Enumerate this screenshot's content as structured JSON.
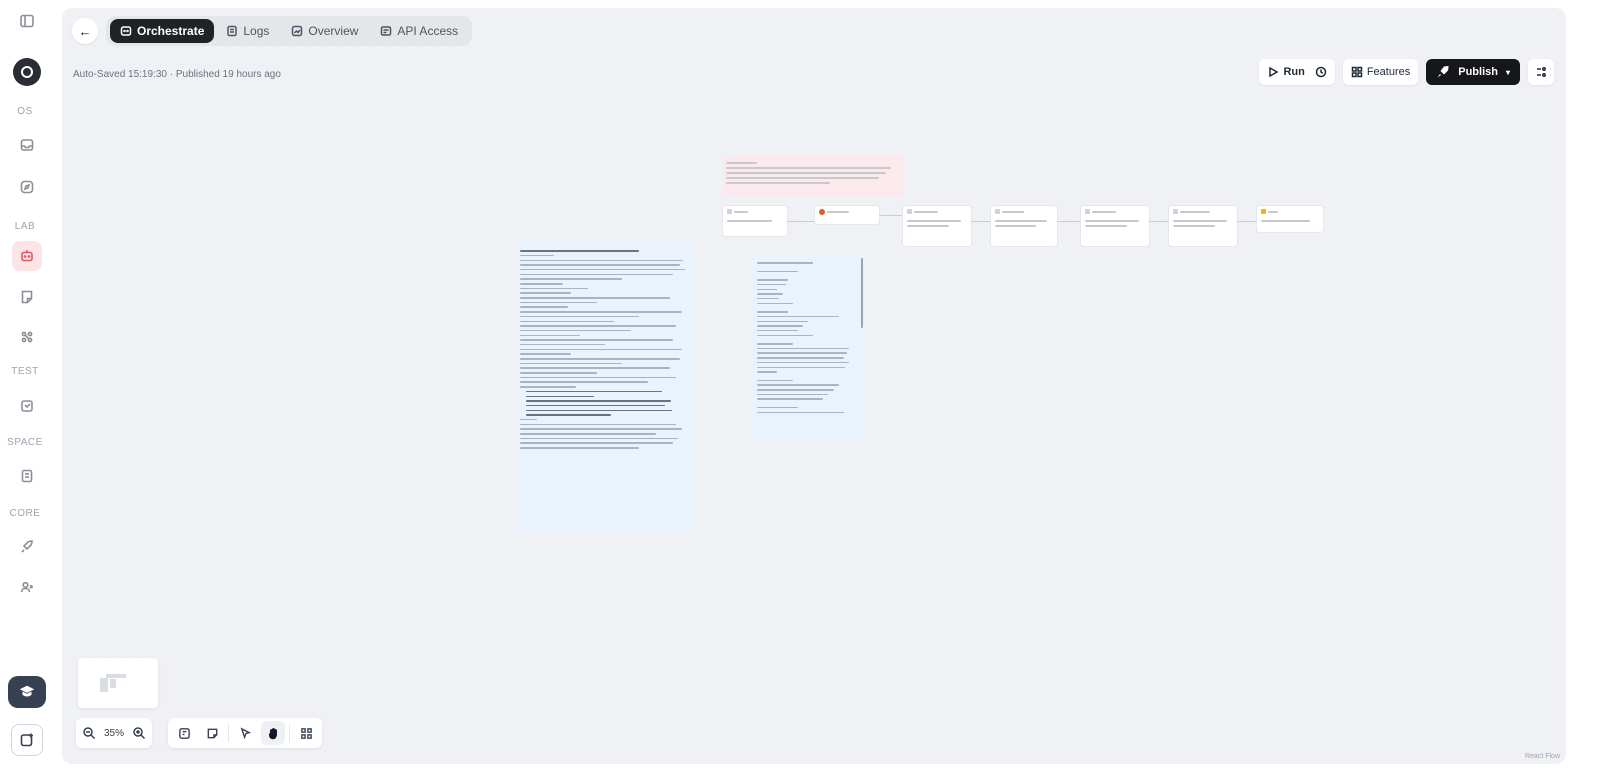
{
  "rail": {
    "sections": [
      "OS",
      "LAB",
      "TEST",
      "SPACE",
      "CORE"
    ],
    "items": [
      {
        "name": "sidebar-toggle",
        "icon": "panel-left-icon"
      },
      {
        "name": "app-logo",
        "icon": "logo-icon"
      },
      {
        "name": "os-item-1",
        "icon": "inbox-icon"
      },
      {
        "name": "os-item-2",
        "icon": "compass-icon"
      },
      {
        "name": "lab-item-1",
        "icon": "bot-icon",
        "active": true
      },
      {
        "name": "lab-item-2",
        "icon": "note-icon"
      },
      {
        "name": "lab-item-3",
        "icon": "nodes-icon"
      },
      {
        "name": "test-item-1",
        "icon": "flask-icon"
      },
      {
        "name": "space-item-1",
        "icon": "book-icon"
      },
      {
        "name": "core-item-1",
        "icon": "rocket-icon"
      },
      {
        "name": "core-item-2",
        "icon": "users-icon"
      }
    ]
  },
  "header": {
    "tabs": [
      {
        "label": "Orchestrate",
        "icon": "orchestrate-icon",
        "active": true
      },
      {
        "label": "Logs",
        "icon": "logs-icon",
        "active": false
      },
      {
        "label": "Overview",
        "icon": "overview-icon",
        "active": false
      },
      {
        "label": "API Access",
        "icon": "api-icon",
        "active": false
      }
    ],
    "autosave": "Auto-Saved 15:19:30 · Published 19 hours ago",
    "run_label": "Run",
    "features_label": "Features",
    "publish_label": "Publish"
  },
  "canvas": {
    "zoom_label": "35%",
    "attribution": "React Flow"
  },
  "colors": {
    "accent": "#e25563",
    "publish_bg": "#15171b",
    "canvas_bg": "#f0f1f4",
    "note_pink": "#fce9ec",
    "doc_blue": "#eaf3fd"
  }
}
